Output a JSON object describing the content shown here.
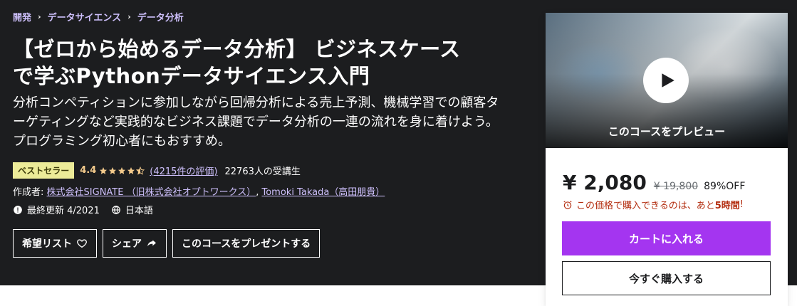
{
  "breadcrumb": [
    "開発",
    "データサイエンス",
    "データ分析"
  ],
  "course": {
    "title_line1": "【ゼロから始めるデータ分析】 ビジネスケース",
    "title_line2": "で学ぶPythonデータサイエンス入門",
    "subtitle": "分析コンペティションに参加しながら回帰分析による売上予測、機械学習での顧客ターゲティングなど実践的なビジネス課題でデータ分析の一連の流れを身に着けよう。 プログラミング初心者にもおすすめ。"
  },
  "rating": {
    "badge": "ベストセラー",
    "score": "4.4",
    "stars": 4.5,
    "reviews": "(4215件の評価)",
    "students": "22763人の受講生"
  },
  "authors": {
    "label": "作成者:",
    "names": [
      "株式会社SIGNATE （旧株式会社オプトワークス）",
      "Tomoki Takada（高田朋貴）"
    ],
    "separator": ","
  },
  "meta": {
    "updated": "最終更新 4/2021",
    "language": "日本語"
  },
  "actions": {
    "wishlist": "希望リスト",
    "share": "シェア",
    "gift": "このコースをプレゼントする"
  },
  "sidebar": {
    "preview_label": "このコースをプレビュー",
    "price": "¥ 2,080",
    "original_price": "¥ 19,800",
    "discount": "89%OFF",
    "urgency_prefix": "この価格で購入できるのは、あと",
    "urgency_time": "5時間",
    "urgency_suffix": "!",
    "add_to_cart": "カートに入れる",
    "buy_now": "今すぐ購入する"
  },
  "colors": {
    "hero_bg": "#1c1d1f",
    "link": "#cec0fc",
    "badge_bg": "#eceb98",
    "star": "#f3ca8c",
    "accent": "#a435f0",
    "urgency": "#b32d0f"
  },
  "icons": [
    "chevron-right-icon",
    "star-icon",
    "half-star-icon",
    "alert-icon",
    "globe-icon",
    "heart-icon",
    "share-arrow-icon",
    "play-icon",
    "alarm-clock-icon"
  ]
}
